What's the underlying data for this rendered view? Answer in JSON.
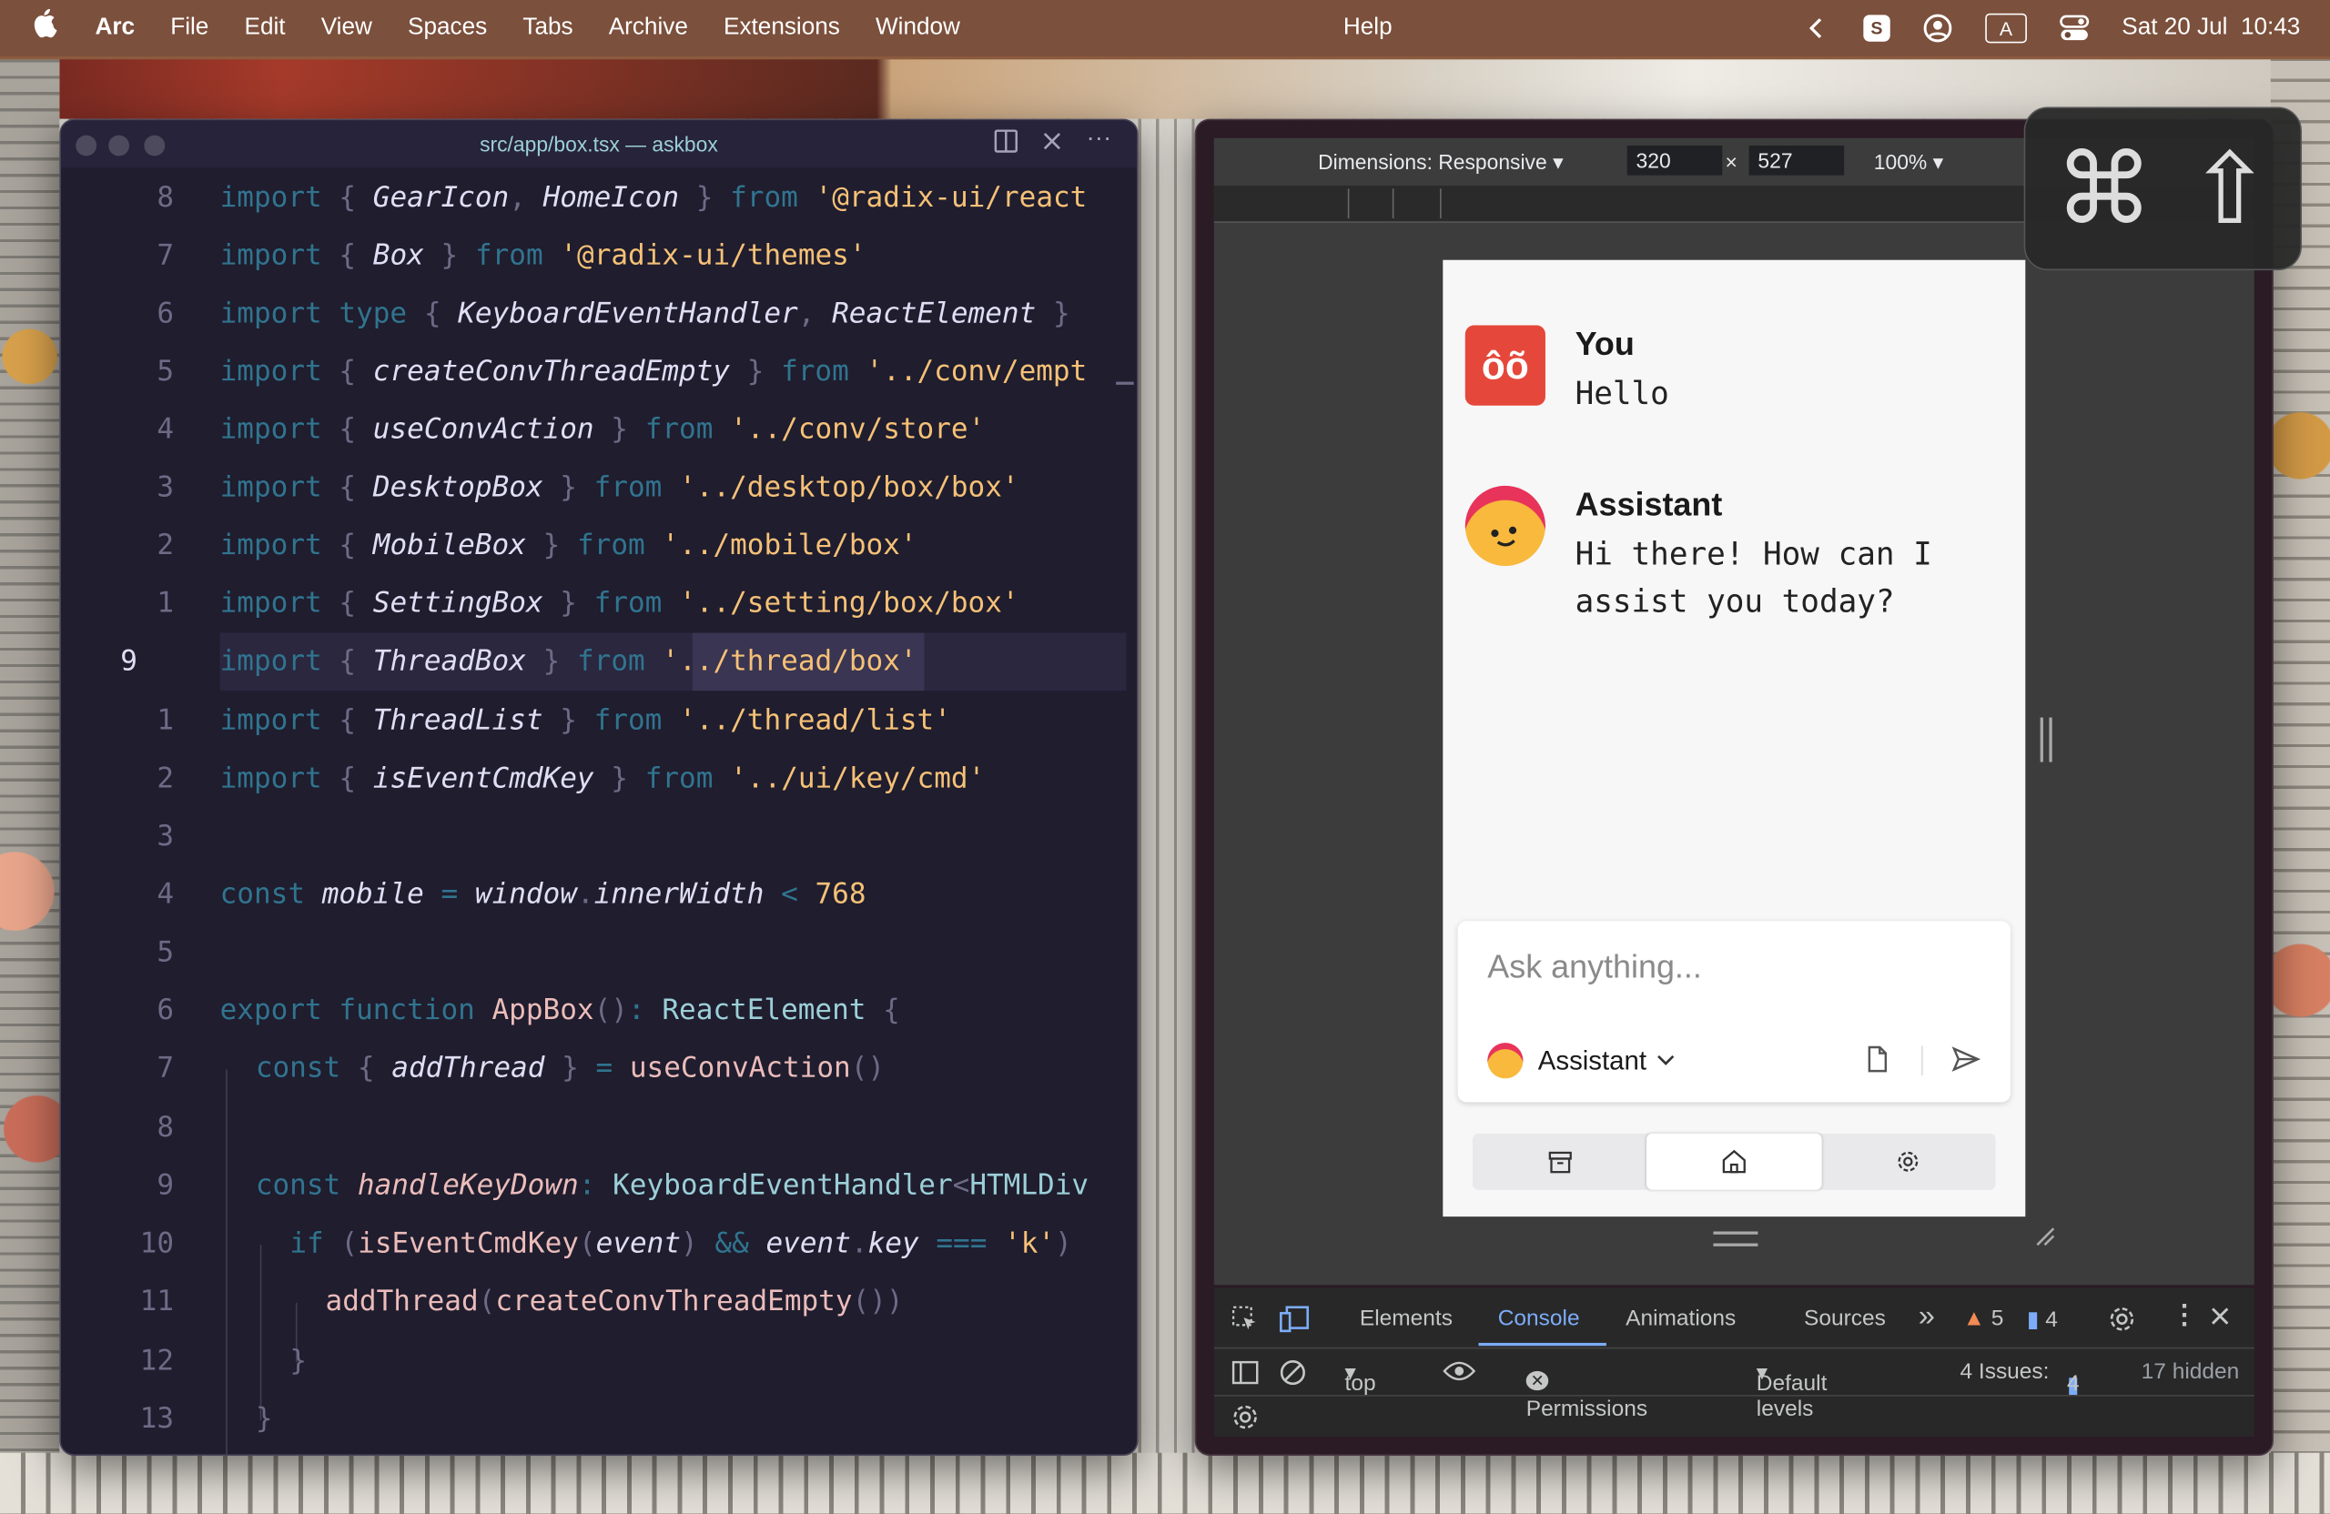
{
  "menubar": {
    "app": "Arc",
    "items": [
      "File",
      "Edit",
      "View",
      "Spaces",
      "Tabs",
      "Archive",
      "Extensions",
      "Window"
    ],
    "help": "Help",
    "status_s": "S",
    "status_a": "A",
    "datetime": "Sat 20 Jul  10:43"
  },
  "editor": {
    "title": "src/app/box.tsx — askbox",
    "line_numbers": [
      "8",
      "7",
      "6",
      "5",
      "4",
      "3",
      "2",
      "1",
      "9",
      "1",
      "2",
      "3",
      "4",
      "5",
      "6",
      "7",
      "8",
      "9",
      "10",
      "11",
      "12",
      "13"
    ]
  },
  "code": {
    "l1": [
      "import",
      "{",
      "GearIcon",
      ",",
      "HomeIcon",
      "}",
      "from",
      "'@radix-ui/react"
    ],
    "l2": [
      "import",
      "{",
      "Box",
      "}",
      "from",
      "'@radix-ui/themes'"
    ],
    "l3": [
      "import",
      "type",
      "{",
      "KeyboardEventHandler",
      ",",
      "ReactElement",
      "}"
    ],
    "l4": [
      "import",
      "{",
      "createConvThreadEmpty",
      "}",
      "from",
      "'../conv/empt"
    ],
    "l5": [
      "import",
      "{",
      "useConvAction",
      "}",
      "from",
      "'../conv/store'"
    ],
    "l6": [
      "import",
      "{",
      "DesktopBox",
      "}",
      "from",
      "'../desktop/box/box'"
    ],
    "l7": [
      "import",
      "{",
      "MobileBox",
      "}",
      "from",
      "'../mobile/box'"
    ],
    "l8": [
      "import",
      "{",
      "SettingBox",
      "}",
      "from",
      "'../setting/box/box'"
    ],
    "l9": [
      "import",
      "{",
      "ThreadBox",
      "}",
      "from",
      "'",
      "../thread/box",
      "'"
    ],
    "l10": [
      "import",
      "{",
      "ThreadList",
      "}",
      "from",
      "'../thread/list'"
    ],
    "l11": [
      "import",
      "{",
      "isEventCmdKey",
      "}",
      "from",
      "'../ui/key/cmd'"
    ],
    "l13": [
      "const",
      "mobile",
      "=",
      "window",
      ".",
      "innerWidth",
      "<",
      "768"
    ],
    "l15": [
      "export",
      "function",
      "AppBox",
      "()",
      ":",
      "ReactElement",
      "{"
    ],
    "l16": [
      "const",
      "{",
      "addThread",
      "}",
      "=",
      "useConvAction",
      "()"
    ],
    "l18": [
      "const",
      "handleKeyDown",
      ":",
      "KeyboardEventHandler",
      "<",
      "HTMLDiv"
    ],
    "l19": [
      "if",
      "(",
      "isEventCmdKey",
      "(",
      "event",
      ")",
      "&&",
      "event",
      ".",
      "key",
      "===",
      "'k'",
      ")"
    ],
    "l20": [
      "addThread",
      "(",
      "createConvThreadEmpty",
      "())"
    ],
    "l21": [
      "}"
    ],
    "l22": [
      "}"
    ]
  },
  "devtools_bar": {
    "dimensions": "Dimensions: Responsive",
    "width": "320",
    "times": "×",
    "height": "527",
    "zoom": "100%"
  },
  "chat": {
    "user_avatar": "ôõ",
    "user_name": "You",
    "user_msg": "Hello",
    "assistant_name": "Assistant",
    "assistant_msg_line1": "Hi there! How can I",
    "assistant_msg_line2": "assist you today?",
    "placeholder": "Ask anything...",
    "model": "Assistant"
  },
  "devtools": {
    "tabs": [
      "Elements",
      "Console",
      "Animations",
      "Sources"
    ],
    "more": "»",
    "warnings": "5",
    "messages": "4",
    "context": "top",
    "filter": "-Permissions",
    "levels": "Default levels",
    "issues_label": "4 Issues:",
    "issues_count": "4",
    "hidden": "17 hidden"
  },
  "overlay": {
    "cmd": "⌘",
    "shift": "⇧"
  }
}
